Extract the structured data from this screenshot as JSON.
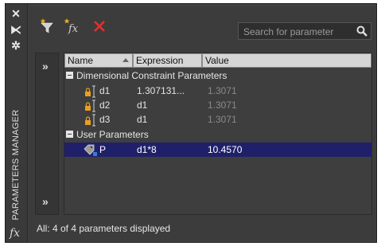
{
  "palette": {
    "title": "PARAMETERS MANAGER",
    "side_buttons": [
      "✕",
      "⧔",
      "✲"
    ],
    "fx_label": "fx"
  },
  "toolbar": {
    "buttons": [
      "new-parameter-filter",
      "new-user-parameter",
      "delete-parameter"
    ],
    "search_placeholder": "Search for parameter"
  },
  "grid": {
    "columns": [
      "Name",
      "Expression",
      "Value"
    ],
    "groups": [
      {
        "label": "Dimensional Constraint Parameters",
        "rows": [
          {
            "name": "d1",
            "expression": "1.307131...",
            "value": "1.3071"
          },
          {
            "name": "d2",
            "expression": "d1",
            "value": "1.3071"
          },
          {
            "name": "d3",
            "expression": "d1",
            "value": "1.3071"
          }
        ]
      },
      {
        "label": "User Parameters",
        "rows": [
          {
            "name": "P",
            "expression": "d1*8",
            "value": "10.4570",
            "selected": true
          }
        ]
      }
    ]
  },
  "filter": {
    "expand_top": "»",
    "expand_bottom": "»"
  },
  "status": {
    "text": "All: 4 of 4 parameters displayed"
  },
  "colors": {
    "panel_bg": "#404040",
    "selection": "#20206a",
    "header_bg": "#d6d6d6",
    "lock_icon": "#e8a020",
    "delete_icon": "#e03030"
  }
}
